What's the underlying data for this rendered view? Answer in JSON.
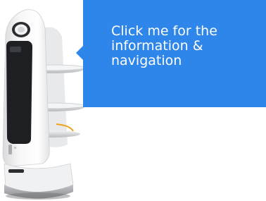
{
  "robot": {
    "icon": "delivery-robot-icon"
  },
  "info_bubble": {
    "text": "Click me for the\ninformation &\nnavigation",
    "background_color": "#2f86ea",
    "text_color": "#ffffff"
  }
}
